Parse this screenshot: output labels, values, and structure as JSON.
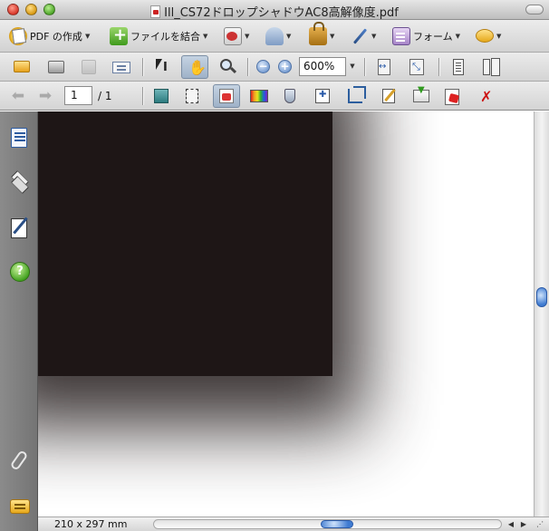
{
  "window": {
    "title": "Ill_CS72ドロップシャドウAC8高解像度.pdf"
  },
  "tasks_toolbar": {
    "create_pdf": "PDF の作成",
    "combine_files": "ファイルを結合",
    "forms": "フォーム"
  },
  "view_toolbar": {
    "zoom_value": "600%"
  },
  "nav_toolbar": {
    "current_page": "1",
    "page_total": "/ 1"
  },
  "status_bar": {
    "page_size": "210 x 297 mm"
  },
  "icons": {
    "create_pdf": "create-pdf-icon",
    "combine": "combine-files-icon",
    "export": "export-icon",
    "review": "review-icon",
    "secure": "lock-icon",
    "sign": "pen-icon",
    "forms": "form-icon",
    "comment": "comment-icon",
    "sidebar": [
      "pages-icon",
      "layers-icon",
      "signatures-icon",
      "help-icon",
      "attachment-icon",
      "comments-icon"
    ]
  },
  "colors": {
    "document_rect": "#1e1616",
    "scroll_thumb": "#3f7bd1"
  }
}
